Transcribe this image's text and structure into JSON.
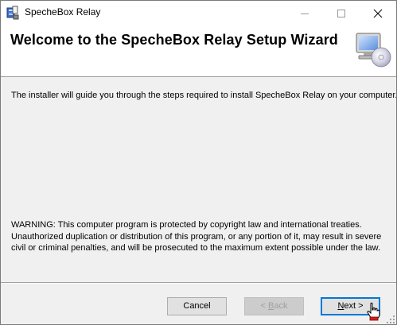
{
  "window": {
    "title": "SpecheBox Relay",
    "controls": [
      "minimize",
      "maximize",
      "close"
    ]
  },
  "banner": {
    "title": "Welcome to the SpecheBox Relay Setup Wizard",
    "graphic": "computer-with-cd-icon"
  },
  "content": {
    "intro": "The installer will guide you through the steps required to install SpecheBox Relay on your computer.",
    "warning": "WARNING: This computer program is protected by copyright law and international treaties. Unauthorized duplication or distribution of this program, or any portion of it, may result in severe civil or criminal penalties, and will be prosecuted to the maximum extent possible under the law."
  },
  "buttons": {
    "cancel": "Cancel",
    "back_prefix": "< ",
    "back_access": "B",
    "back_rest": "ack",
    "next_access": "N",
    "next_rest": "ext >"
  },
  "colors": {
    "focus_border": "#0078d7",
    "disabled_text": "#a0a0a0",
    "dialog_bg": "#f0f0f0"
  }
}
